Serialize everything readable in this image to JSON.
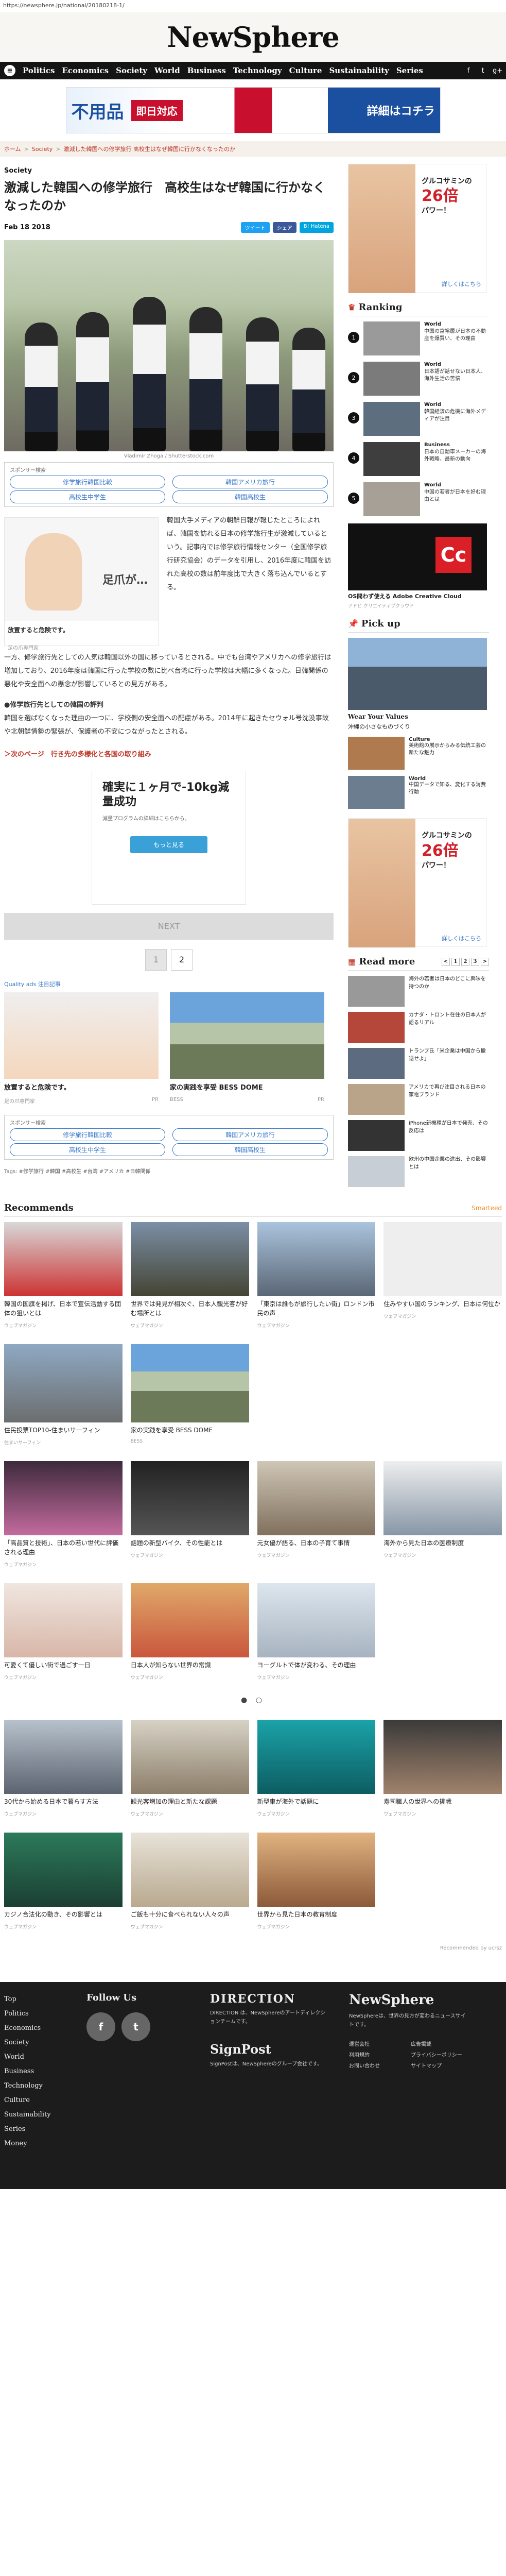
{
  "url": "https://newsphere.jp/national/20180218-1/",
  "site": {
    "title": "NewSphere"
  },
  "nav": {
    "items": [
      "Politics",
      "Economics",
      "Society",
      "World",
      "Business",
      "Technology",
      "Culture",
      "Sustainability",
      "Series"
    ],
    "social": [
      "f",
      "t",
      "g+"
    ]
  },
  "ad_top": {
    "text1": "不用品",
    "text2": "即日対応",
    "text3": "詳細はコチラ"
  },
  "breadcrumb": [
    "ホーム",
    "Society",
    "激減した韓国への修学旅行 高校生はなぜ韓国に行かなくなったのか"
  ],
  "article": {
    "category": "Society",
    "title": "激減した韓国への修学旅行　高校生はなぜ韓国に行かなくなったのか",
    "date": "Feb 18 2018",
    "share": [
      "ツイート",
      "シェア",
      "B! Hatena"
    ],
    "credit": "Vladimir Zhoga / Shutterstock.com",
    "sponsor_label": "スポンサー検索",
    "tags": [
      "修学旅行韓国比較",
      "韓国アメリカ旅行",
      "高校生中学生",
      "韓国高校生"
    ],
    "ad_inline": {
      "title": "陰部ヶる～",
      "label": "足爪が…",
      "foot": "放置すると危険です。",
      "sub": "足の爪専門家"
    },
    "body1": "韓国大手メディアの朝鮮日報が報じたところによれば、韓国を訪れる日本の修学旅行生が激減しているという。記事内では修学旅行情報センター（全国修学旅行研究協会）のデータを引用し、2016年度に韓国を訪れた高校の数は前年度比で大きく落ち込んでいるとする。",
    "body2": "一方、修学旅行先としての人気は韓国以外の国に移っているとされる。中でも台湾やアメリカへの修学旅行は増加しており、2016年度は韓国に行った学校の数に比べ台湾に行った学校は大幅に多くなった。日韓関係の悪化や安全面への懸念が影響しているとの見方がある。",
    "section_head": "●修学旅行先としての韓国の評判",
    "body3": "韓国を選ばなくなった理由の一つに、学校側の安全面への配慮がある。2014年に起きたセウォル号沈没事故や北朝鮮情勢の緊張が、保護者の不安につながったとされる。",
    "next": "＞次のページ　行き先の多様化と各国の取り組み"
  },
  "ad_square": {
    "big": "確実に１ヶ月で-10kg減量成功",
    "small": "減量プログラムの詳細はこちらから。",
    "button": "もっと見る"
  },
  "next_bar": "NEXT",
  "pager": [
    "1",
    "2"
  ],
  "related": {
    "head": "Quality ads 注目記事",
    "cards": [
      {
        "title": "放置すると危険です。",
        "src": "足の爪専門家"
      },
      {
        "title": "家の実践を享受 BESS DOME",
        "src": "BESS"
      }
    ]
  },
  "tag_line": "Tags: #修学旅行 #韓国 #高校生 #台湾 #アメリカ #日韓関係",
  "sidebar": {
    "ad1": {
      "line1": "グルコサミンの",
      "big": "26倍",
      "line2": "パワー！",
      "more": "詳しくはこちら"
    },
    "ranking_head": "Ranking",
    "ranking": [
      {
        "num": "1",
        "cat": "World",
        "title": "中国の富裕層が日本の不動産を爆買い、その理由"
      },
      {
        "num": "2",
        "cat": "World",
        "title": "日本語が話せない日本人、海外生活の苦悩"
      },
      {
        "num": "3",
        "cat": "World",
        "title": "韓国経済の危機に海外メディアが注目"
      },
      {
        "num": "4",
        "cat": "Business",
        "title": "日本の自動車メーカーの海外戦略、最新の動向"
      },
      {
        "num": "5",
        "cat": "World",
        "title": "中国の若者が日本を好む理由とは"
      }
    ],
    "adobe": {
      "cap": "OS問わず使える Adobe Creative Cloud",
      "sm": "アドビ クリエイティブクラウド"
    },
    "pickup_head": "Pick up",
    "pickup_main": {
      "head": "Wear Your Values",
      "cap": "沖縄の小さなものづくり"
    },
    "pickup": [
      {
        "cat": "Culture",
        "title": "美術館の展示からみる伝統工芸の新たな魅力"
      },
      {
        "cat": "World",
        "title": "中国データで知る、変化する消費行動"
      }
    ],
    "ad2": {
      "line1": "グルコサミンの",
      "big": "26倍",
      "line2": "パワー！",
      "more": "詳しくはこちら"
    },
    "readmore_head": "Read more",
    "readmore_pages": [
      "<",
      "1",
      "2",
      "3",
      ">"
    ],
    "readmore": [
      "海外の若者は日本のどこに興味を持つのか",
      "カナダ・トロント在住の日本人が語るリアル",
      "トランプ氏「米企業は中国から撤退せよ」",
      "アメリカで再び注目される日本の家電ブランド",
      "iPhone新機種が日本で発売、その反応は",
      "欧州の中国企業の進出、その影響とは"
    ]
  },
  "recommendations": {
    "head": "Recommends",
    "source": "Smarteed",
    "cards": [
      {
        "title": "韓国の国旗を掲げ、日本で宣伝活動する団体の狙いとは",
        "src": "ウェブマガジン"
      },
      {
        "title": "世界では発見が相次ぐ、日本人観光客が好む場所とは",
        "src": "ウェブマガジン"
      },
      {
        "title": "「東京は誰もが旅行したい街」ロンドン市民の声",
        "src": "ウェブマガジン"
      },
      {
        "title": "住みやすい国のランキング、日本は何位か",
        "src": "ウェブマガジン"
      }
    ],
    "cards2": [
      {
        "title": "住民投票TOP10-住まいサーフィン",
        "src": "住まいサーフィン"
      },
      {
        "title": "家の実践を享受 BESS DOME",
        "src": "BESS"
      }
    ],
    "cards3": [
      {
        "title": "「高品質と技術」、日本の若い世代に評価される理由",
        "src": "ウェブマガジン"
      },
      {
        "title": "話題の新型バイク、その性能とは",
        "src": "ウェブマガジン"
      },
      {
        "title": "元女優が語る、日本の子育て事情",
        "src": "ウェブマガジン"
      },
      {
        "title": "海外から見た日本の医療制度",
        "src": "ウェブマガジン"
      }
    ],
    "cards4": [
      {
        "title": "可愛くて優しい街で過ごす一日",
        "src": "ウェブマガジン"
      },
      {
        "title": "日本人が知らない世界の常識",
        "src": "ウェブマガジン"
      },
      {
        "title": "ヨーグルトで体が変わる、その理由",
        "src": "ウェブマガジン"
      },
      {
        "title": "",
        "src": ""
      }
    ],
    "cards5": [
      {
        "title": "30代から始める日本で暮らす方法",
        "src": "ウェブマガジン"
      },
      {
        "title": "観光客増加の理由と新たな課題",
        "src": "ウェブマガジン"
      },
      {
        "title": "新型車が海外で話題に",
        "src": "ウェブマガジン"
      },
      {
        "title": "寿司職人の世界への挑戦",
        "src": "ウェブマガジン"
      }
    ],
    "cards6": [
      {
        "title": "カジノ合法化の動き、その影響とは",
        "src": "ウェブマガジン"
      },
      {
        "title": "ご飯も十分に食べられない人々の声",
        "src": "ウェブマガジン"
      },
      {
        "title": "世界から見た日本の教育制度",
        "src": "ウェブマガジン"
      },
      {
        "title": "",
        "src": ""
      }
    ],
    "powered": "Recommended by ucrsz"
  },
  "footer": {
    "nav": [
      "Top",
      "Politics",
      "Economics",
      "Society",
      "World",
      "Business",
      "Technology",
      "Culture",
      "Sustainability",
      "Series",
      "Money"
    ],
    "follow": "Follow Us",
    "follow_icons": [
      "f",
      "t"
    ],
    "direction_head": "DIRECTION",
    "direction_text": "DIRECTION は、NewSphereのアートディレクションチームです。",
    "signpost": "SignPost",
    "signpost_text": "SignPostは、NewSphereのグループ会社です。",
    "ns_head": "NewSphere",
    "ns_text": "NewSphereは、世界の見方が変わるニュースサイトです。",
    "links": [
      "運営会社",
      "広告掲載",
      "利用規約",
      "プライバシーポリシー",
      "お問い合わせ",
      "サイトマップ"
    ]
  },
  "colors": {
    "accent": "#c0392b",
    "nav_bg": "#141414",
    "link_blue": "#3a78c9",
    "footer_bg": "#1c1c1c"
  }
}
